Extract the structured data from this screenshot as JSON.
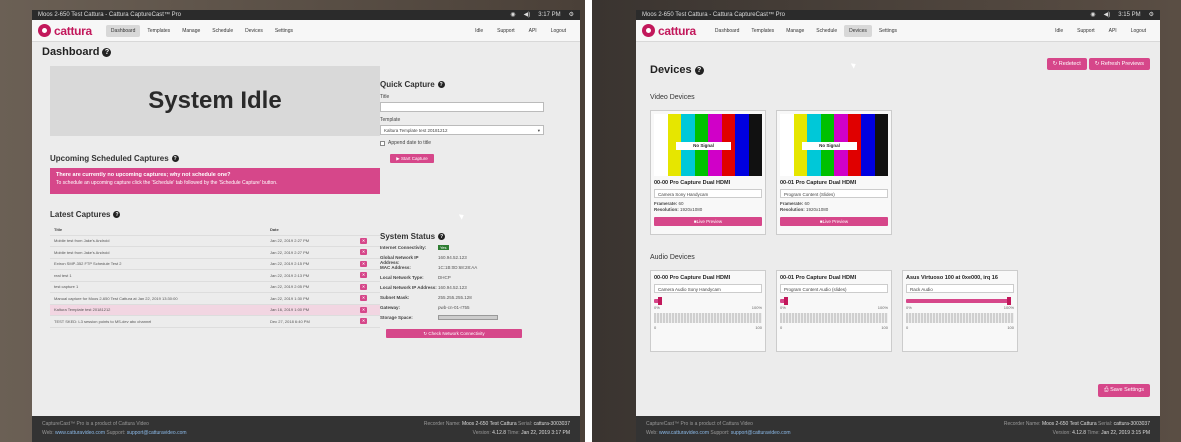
{
  "left": {
    "os_title": "Moos 2-650 Test Cattura - Cattura CaptureCast™ Pro",
    "clock": "3:17 PM",
    "logo": "cattura",
    "nav": [
      "Dashboard",
      "Templates",
      "Manage",
      "Schedule",
      "Devices",
      "Settings"
    ],
    "nav_right": [
      "Idle",
      "Support",
      "API",
      "Logout"
    ],
    "page_title": "Dashboard",
    "system_idle": "System Idle",
    "upcoming_title": "Upcoming Scheduled Captures",
    "alert_title": "There are currently no upcoming captures; why not schedule one?",
    "alert_body": "To schedule an upcoming capture click the 'Schedule' tab followed by the 'Schedule Capture' button.",
    "latest_title": "Latest Captures",
    "captures_head": {
      "title": "Title",
      "date": "Date"
    },
    "captures": [
      {
        "title": "Mobile test from Jake's Android",
        "date": "Jan 22, 2019 2:27 PM"
      },
      {
        "title": "Mobile test from Jake's Android",
        "date": "Jan 22, 2019 2:27 PM"
      },
      {
        "title": "Extron SMP-352 FTP Schedule Test 2",
        "date": "Jan 22, 2019 2:15 PM"
      },
      {
        "title": "real test 1",
        "date": "Jan 22, 2019 2:13 PM"
      },
      {
        "title": "test capture 1",
        "date": "Jan 22, 2019 2:05 PM"
      },
      {
        "title": "Manual capture for Moos 2-650 Test Cattura at Jan 22, 2019 13:30:00",
        "date": "Jan 22, 2019 1:30 PM"
      },
      {
        "title": "Kaltura Template test 20181212",
        "date": "Jan 16, 2019 1:00 PM"
      },
      {
        "title": "TEST SKED: L3 session points to MS-dev abc channel",
        "date": "Dec 27, 2018 6:40 PM"
      }
    ],
    "quick_capture": {
      "title": "Quick Capture",
      "title_label": "Title",
      "template_label": "Template",
      "template_value": "Kaltura Template test 20181212",
      "append_label": "Append date to title",
      "start_button": "▶ Start Capture"
    },
    "system_status": {
      "title": "System Status",
      "rows": [
        {
          "k": "Internet Connectivity:",
          "v": "Yes"
        },
        {
          "k": "Global Network IP Address:",
          "v": "160.94.52.123"
        },
        {
          "k": "MAC Address:",
          "v": "1C:1B:0D:68:28:AA"
        },
        {
          "k": "Local Network Type:",
          "v": "DHCP"
        },
        {
          "k": "Local Network IP Address:",
          "v": "160.94.52.123"
        },
        {
          "k": "Subnet Mask:",
          "v": "255.255.255.128"
        },
        {
          "k": "Gateway:",
          "v": "pwb-cn-01-r755"
        },
        {
          "k": "Storage Space:",
          "v": ""
        }
      ],
      "check_button": "Check Network Connectivity"
    },
    "footer": {
      "line1": "CaptureCast™ Pro is a product of Cattura Video",
      "web_label": "Web:",
      "web_link": "www.catturavideo.com",
      "support_label": "Support:",
      "support_link": "support@catturavideo.com",
      "recorder_label": "Recorder Name:",
      "recorder_name": "Moos 2-650 Test Cattura",
      "serial_label": "Serial:",
      "serial": "cattura-3003037",
      "version_label": "Version:",
      "version": "4.12.8",
      "time_label": "Time:",
      "time": "Jan 22, 2019 3:17 PM"
    }
  },
  "right": {
    "os_title": "Moos 2-650 Test Cattura - Cattura CaptureCast™ Pro",
    "clock": "3:15 PM",
    "logo": "cattura",
    "nav": [
      "Dashboard",
      "Templates",
      "Manage",
      "Schedule",
      "Devices",
      "Settings"
    ],
    "nav_right": [
      "Idle",
      "Support",
      "API",
      "Logout"
    ],
    "page_title": "Devices",
    "redetect_button": "Redetect",
    "refresh_button": "Refresh Previews",
    "video_title": "Video Devices",
    "audio_title": "Audio Devices",
    "no_signal": "No Signal",
    "video_devices": [
      {
        "name": "00-00 Pro Capture Dual HDMI",
        "input": "Camera Sony Handycam",
        "framerate": "60",
        "resolution": "1920x1080"
      },
      {
        "name": "00-01 Pro Capture Dual HDMI",
        "input": "Program Content (Slides)",
        "framerate": "60",
        "resolution": "1920x1080"
      }
    ],
    "framerate_label": "Framerate:",
    "resolution_label": "Resolution:",
    "live_preview": "Live Preview",
    "audio_devices": [
      {
        "name": "00-00 Pro Capture Dual HDMI",
        "input": "Camera Audio Sony Handycam",
        "level": 0.05,
        "min": "0%",
        "max": "100%"
      },
      {
        "name": "00-01 Pro Capture Dual HDMI",
        "input": "Program Content Audio (slides)",
        "level": 0.05,
        "min": "0%",
        "max": "100%"
      },
      {
        "name": "Asus Virtuoso 100 at 0xe000, irq 16",
        "input": "Rack Audio",
        "level": 0.95,
        "min": "0%",
        "max": "100%"
      }
    ],
    "meter_scale": [
      "0",
      "100"
    ],
    "save_button": "Save Settings",
    "footer": {
      "line1": "CaptureCast™ Pro is a product of Cattura Video",
      "web_label": "Web:",
      "web_link": "www.catturavideo.com",
      "support_label": "Support:",
      "support_link": "support@catturavideo.com",
      "recorder_label": "Recorder Name:",
      "recorder_name": "Moos 2-650 Test Cattura",
      "serial_label": "Serial:",
      "serial": "cattura-3003037",
      "version_label": "Version:",
      "version": "4.12.8",
      "time_label": "Time:",
      "time": "Jan 22, 2019 3:15 PM"
    },
    "colors": {
      "accent": "#c2185b",
      "button": "#d6478a"
    }
  }
}
